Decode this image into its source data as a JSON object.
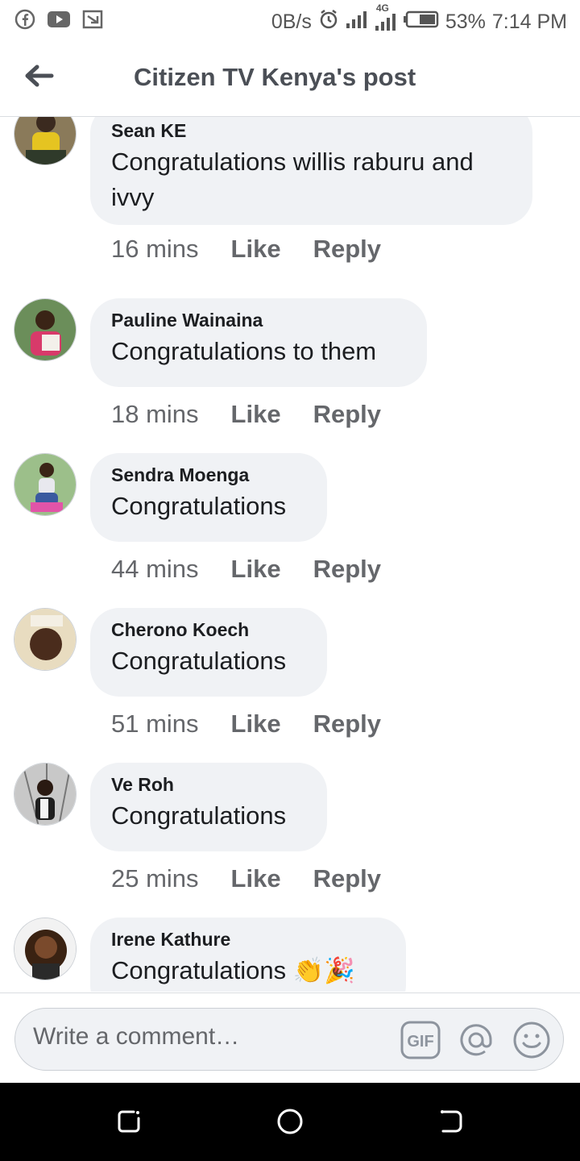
{
  "status_bar": {
    "net_speed": "0B/s",
    "network": "4G",
    "battery": "53%",
    "time": "7:14 PM"
  },
  "header": {
    "title": "Citizen TV Kenya's post"
  },
  "comments": [
    {
      "author": "Sean KE",
      "text": "Congratulations willis raburu and ivvy",
      "time": "16 mins",
      "like": "Like",
      "reply": "Reply"
    },
    {
      "author": "Pauline Wainaina",
      "text": "Congratulations to them",
      "time": "18 mins",
      "like": "Like",
      "reply": "Reply"
    },
    {
      "author": "Sendra Moenga",
      "text": "Congratulations",
      "time": "44 mins",
      "like": "Like",
      "reply": "Reply"
    },
    {
      "author": "Cherono Koech",
      "text": "Congratulations",
      "time": "51 mins",
      "like": "Like",
      "reply": "Reply"
    },
    {
      "author": "Ve Roh",
      "text": "Congratulations",
      "time": "25 mins",
      "like": "Like",
      "reply": "Reply"
    },
    {
      "author": "Irene Kathure",
      "text": "Congratulations 👏🎉",
      "time": "",
      "like": "",
      "reply": ""
    }
  ],
  "composer": {
    "placeholder": "Write a comment…",
    "icons": [
      "gif-icon",
      "at-mention-icon",
      "emoji-icon"
    ]
  },
  "nav_bar": {
    "icons": [
      "recent-apps-icon",
      "home-icon",
      "back-icon"
    ]
  },
  "colors": {
    "bubble": "#f0f2f5",
    "meta_text": "#65676b",
    "header_text": "#4b4f56"
  }
}
